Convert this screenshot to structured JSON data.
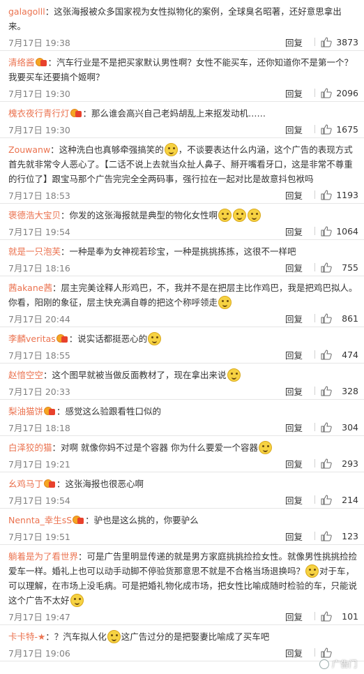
{
  "reply_label": "回复",
  "watermark": "广告门",
  "comments": [
    {
      "user": "galagolll",
      "badge": false,
      "text": "这张海报被众多国家视为女性拟物化的案例，全球臭名昭著，还好意思拿出来。",
      "time": "7月17日 19:38",
      "likes": "3873",
      "emojis": 0
    },
    {
      "user": "清络酱",
      "badge": true,
      "text": "汽车行业是不是把买家默认男性啊？女性不能买车，还你知道你不是第一个？我要买车还要搞个姬啊？",
      "time": "7月17日 19:30",
      "likes": "2096",
      "emojis": 0
    },
    {
      "user": "槐衣夜行青行灯",
      "badge": true,
      "text": "那么谁会高兴自己老妈胡乱上来抠发动机……",
      "time": "7月17日 19:30",
      "likes": "1675",
      "emojis": 0
    },
    {
      "user": "Zouwanw",
      "badge": false,
      "text": "这种洗白也真够牵强搞笑的",
      "text2": "，不谈要表达什么内涵，这个广告的表现方式首先就非常令人恶心了。【二话不说上去就当众扯人鼻子、掰开嘴看牙口，这是非常不尊重的行位了】跟宝马那个广告完完全全两码事，强行拉在一起对比是故意抖包袱吗",
      "time": "7月17日 18:53",
      "likes": "1193",
      "emojis": 1
    },
    {
      "user": "褒德浩大宝贝",
      "badge": false,
      "text": "你发的这张海报就是典型的物化女性啊",
      "time": "7月17日 19:54",
      "likes": "1064",
      "emojis": 3
    },
    {
      "user": "就是一只泡芙",
      "badge": false,
      "text": "一种是奉为女神视若珍宝，一种是挑挑拣拣，这很不一样吧",
      "time": "7月17日 18:16",
      "likes": "755",
      "emojis": 0
    },
    {
      "user": "茜akane茜",
      "badge": false,
      "text": "层主完美诠释人形鸡巴，不，我并不是在把层主比作鸡巴，我是把鸡巴拟人。你看，阳刚的象征，层主快充满自尊的把这个称呼领走",
      "time": "7月17日 20:44",
      "likes": "861",
      "emojis": 1
    },
    {
      "user": "李麟veritas",
      "badge": true,
      "text": "说实话都挺恶心的",
      "time": "7月17日 18:55",
      "likes": "474",
      "emojis": 1
    },
    {
      "user": "赵愔空空",
      "badge": false,
      "text": "这个图早就被当做反面教材了，现在拿出来说",
      "time": "7月17日 20:33",
      "likes": "328",
      "emojis": 1
    },
    {
      "user": "梨油猫饼",
      "badge": true,
      "text": "感觉这么验跟看牲口似的",
      "time": "7月17日 18:18",
      "likes": "304",
      "emojis": 0
    },
    {
      "user": "白泽狡的猫",
      "badge": false,
      "text": "对啊 就像你妈不过是个容器 你为什么要爱一个容器",
      "time": "7月17日 19:21",
      "likes": "293",
      "emojis": 1
    },
    {
      "user": "幺鸡马丁",
      "badge": true,
      "text": "这张海报也很恶心啊",
      "time": "7月17日 19:54",
      "likes": "214",
      "emojis": 0
    },
    {
      "user": "Nennta_幸生sS",
      "badge": true,
      "text": "驴也是这么挑的，你要驴么",
      "time": "7月17日 19:51",
      "likes": "123",
      "emojis": 0
    },
    {
      "user": "躺着是为了看世界",
      "badge": false,
      "text": "可是广告里明显传递的就是男方家庭挑挑捡捡女性。就像男性挑挑捡捡爱车一样。婚礼上也可以动手动脚不停验货那意思不就是不合格当场退换吗？",
      "text2": "对于车，可以理解，在市场上没毛病。可是把婚礼物化成市场，把女性比喻成随时检验的车，只能说这个广告不太好",
      "time": "7月17日 19:47",
      "likes": "101",
      "emojis": 1,
      "emojis_end": 1
    },
    {
      "user": "卡卡特-★",
      "badge": false,
      "text": "？汽车拟人化",
      "text2": "这广告过分的是把娶妻比喻成了买车吧",
      "time": "7月17日 19:06",
      "likes": "",
      "emojis": 1
    }
  ]
}
